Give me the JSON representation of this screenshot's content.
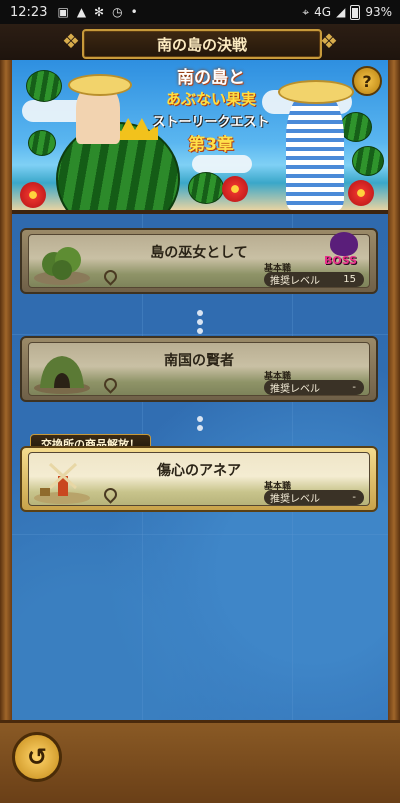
{
  "status_bar": {
    "time": "12:23",
    "network": "4G",
    "battery": "93%",
    "icons": [
      "image-icon",
      "warning-icon",
      "gear-icon",
      "alarm-icon",
      "dot-icon",
      "location-icon",
      "signal-icon",
      "battery-icon"
    ]
  },
  "header": {
    "title": "南の島の決戦"
  },
  "banner": {
    "logo_line1": "南の島と",
    "logo_line2": "あぶない果実",
    "logo_line3": "ストーリークエスト",
    "logo_line4": "第3章",
    "help_label": "?"
  },
  "quests": [
    {
      "name": "島の巫女として",
      "job": "基本職",
      "level_label": "推奨レベル",
      "level_value": "15",
      "boss": true,
      "boss_label": "BOSS",
      "active": false
    },
    {
      "name": "南国の賢者",
      "job": "基本職",
      "level_label": "推奨レベル",
      "level_value": "-",
      "boss": false,
      "active": false
    },
    {
      "name": "傷心のアネア",
      "job": "基本職",
      "level_label": "推奨レベル",
      "level_value": "-",
      "boss": false,
      "active": true
    }
  ],
  "unlock_tag": "交換所の商品解放！",
  "footer": {
    "back_icon": "back-arrow-icon"
  },
  "colors": {
    "frame": "#8a5a25",
    "map": "#3474b8",
    "gold": "#c79a3b",
    "card_active": "#f4ecd2"
  }
}
